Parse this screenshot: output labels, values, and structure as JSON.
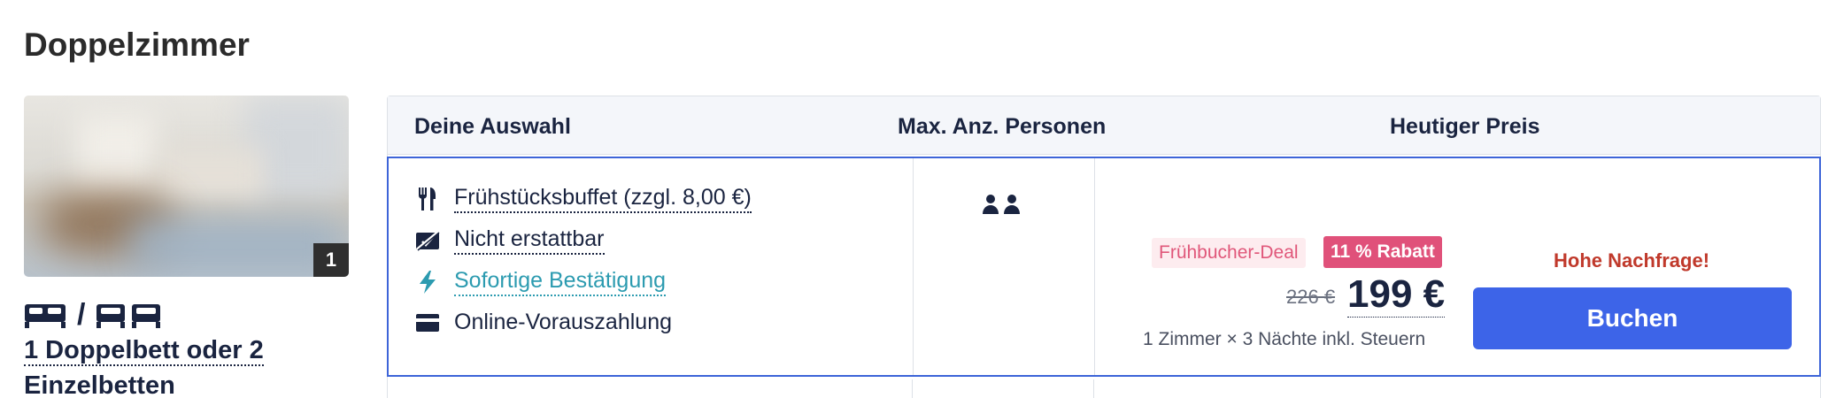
{
  "room": {
    "title": "Doppelzimmer",
    "photo_count": "1",
    "bed_separator": "/",
    "bed_description": "1 Doppelbett oder 2 Einzelbetten"
  },
  "table": {
    "headers": {
      "selection": "Deine Auswahl",
      "max_persons": "Max. Anz. Personen",
      "price": "Heutiger Preis"
    },
    "features": [
      {
        "icon": "fork-knife-icon",
        "label": "Frühstücksbuffet (zzgl. 8,00 €)",
        "style": "dotted"
      },
      {
        "icon": "non-refundable-icon",
        "label": "Nicht erstattbar",
        "style": "dotted"
      },
      {
        "icon": "lightning-icon",
        "label": "Sofortige Bestätigung",
        "style": "link"
      },
      {
        "icon": "credit-card-icon",
        "label": "Online-Vorauszahlung",
        "style": "plain"
      }
    ],
    "persons_icon": "two-persons-icon",
    "price": {
      "deal_label": "Frühbucher-Deal",
      "discount_badge": "11 % Rabatt",
      "old_price": "226 €",
      "new_price": "199 €",
      "note": "1 Zimmer × 3 Nächte inkl. Steuern"
    },
    "demand_label": "Hohe Nachfrage!",
    "book_button": "Buchen"
  },
  "colors": {
    "accent": "#3d64e8",
    "row_border": "#3d64d8",
    "deal_pink": "#e0517a",
    "demand_red": "#c0392b",
    "link_teal": "#2c9bb0",
    "text_dark": "#1a2440"
  }
}
